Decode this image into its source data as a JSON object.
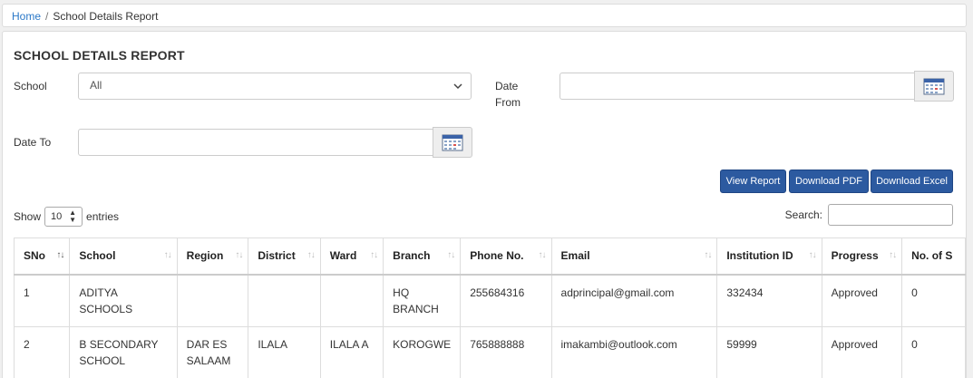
{
  "breadcrumb": {
    "home": "Home",
    "separator": "/",
    "current": "School Details Report"
  },
  "page_title": "SCHOOL DETAILS REPORT",
  "filters": {
    "school_label": "School",
    "school_value": "All",
    "date_from_label_1": "Date",
    "date_from_label_2": "From",
    "date_to_label": "Date To"
  },
  "buttons": {
    "view_report": "View Report",
    "download_pdf": "Download PDF",
    "download_excel": "Download Excel"
  },
  "table_controls": {
    "show_label": "Show",
    "entries_value": "10",
    "entries_label": "entries",
    "search_label": "Search:"
  },
  "table": {
    "columns": [
      "SNo",
      "School",
      "Region",
      "District",
      "Ward",
      "Branch",
      "Phone No.",
      "Email",
      "Institution ID",
      "Progress",
      "No. of S"
    ],
    "rows": [
      {
        "sno": "1",
        "school_1": "ADITYA",
        "school_2": "SCHOOLS",
        "region_1": "",
        "region_2": "",
        "district": "",
        "ward": "",
        "branch_1": "HQ",
        "branch_2": "BRANCH",
        "phone": "255684316",
        "email": "adprincipal@gmail.com",
        "institution_id": "332434",
        "progress": "Approved",
        "count": "0"
      },
      {
        "sno": "2",
        "school_1": "B SECONDARY",
        "school_2": "SCHOOL",
        "region_1": "DAR ES",
        "region_2": "SALAAM",
        "district": "ILALA",
        "ward": "ILALA A",
        "branch_1": "KOROGWE",
        "branch_2": "",
        "phone": "765888888",
        "email": "imakambi@outlook.com",
        "institution_id": "59999",
        "progress": "Approved",
        "count": "0"
      }
    ]
  },
  "colors": {
    "primary_button": "#2c5aa0",
    "link": "#2a78c8"
  },
  "icons": {
    "calendar": "calendar-icon",
    "chevron": "chevron-down-icon",
    "sort": "sort-icon"
  }
}
